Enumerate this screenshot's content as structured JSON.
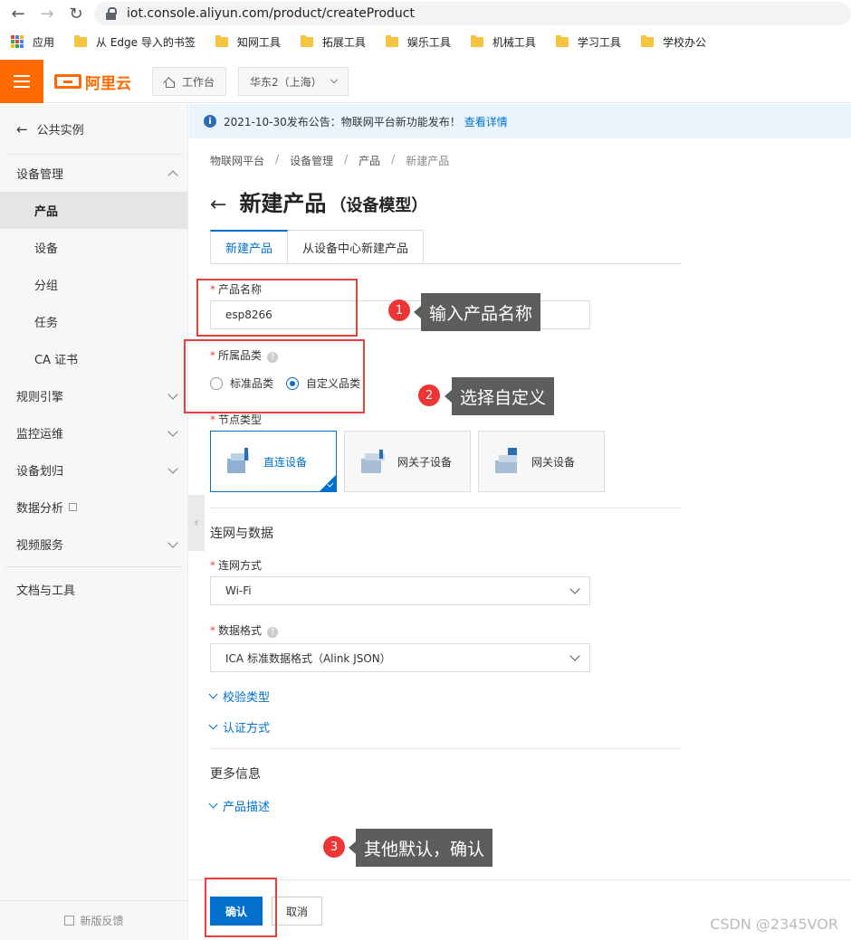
{
  "browser": {
    "url": "iot.console.aliyun.com/product/createProduct",
    "bookmarks": [
      "应用",
      "从 Edge 导入的书签",
      "知网工具",
      "拓展工具",
      "娱乐工具",
      "机械工具",
      "学习工具",
      "学校办公"
    ]
  },
  "topbar": {
    "logo_text": "阿里云",
    "workbench": "工作台",
    "region": "华东2（上海）"
  },
  "sidebar": {
    "back": "公共实例",
    "items": [
      {
        "label": "设备管理",
        "type": "group",
        "caret": "up"
      },
      {
        "label": "产品",
        "type": "sub",
        "active": true
      },
      {
        "label": "设备",
        "type": "sub"
      },
      {
        "label": "分组",
        "type": "sub"
      },
      {
        "label": "任务",
        "type": "sub"
      },
      {
        "label": "CA 证书",
        "type": "sub"
      },
      {
        "label": "规则引擎",
        "type": "group",
        "caret": "down"
      },
      {
        "label": "监控运维",
        "type": "group",
        "caret": "down"
      },
      {
        "label": "设备划归",
        "type": "group",
        "caret": "down"
      },
      {
        "label": "数据分析",
        "type": "group",
        "external": true
      },
      {
        "label": "视频服务",
        "type": "group",
        "caret": "down"
      }
    ],
    "docs": "文档与工具",
    "feedback": "新版反馈"
  },
  "notice": {
    "text": "2021-10-30发布公告：物联网平台新功能发布！",
    "link": "查看详情"
  },
  "breadcrumb": [
    "物联网平台",
    "设备管理",
    "产品",
    "新建产品"
  ],
  "page": {
    "title": "新建产品",
    "subtitle": "（设备模型）"
  },
  "tabs": [
    "新建产品",
    "从设备中心新建产品"
  ],
  "form": {
    "product_name_label": "产品名称",
    "product_name_value": "esp8266",
    "category_label": "所属品类",
    "category_options": [
      "标准品类",
      "自定义品类"
    ],
    "category_selected": 1,
    "node_type_label": "节点类型",
    "node_types": [
      "直连设备",
      "网关子设备",
      "网关设备"
    ],
    "node_selected": 0,
    "section_network": "连网与数据",
    "network_label": "连网方式",
    "network_value": "Wi-Fi",
    "format_label": "数据格式",
    "format_value": "ICA 标准数据格式（Alink JSON）",
    "verify_type": "校验类型",
    "auth_method": "认证方式",
    "section_more": "更多信息",
    "product_desc": "产品描述"
  },
  "buttons": {
    "confirm": "确认",
    "cancel": "取消"
  },
  "annotations": [
    {
      "num": "1",
      "text": "输入产品名称"
    },
    {
      "num": "2",
      "text": "选择自定义"
    },
    {
      "num": "3",
      "text": "其他默认，确认"
    }
  ],
  "watermark": "CSDN @2345VOR",
  "colors": {
    "brand": "#ff6a00",
    "primary": "#0070cc",
    "annotation_red": "#e5403b",
    "callout_bg": "#5d5d5d"
  }
}
